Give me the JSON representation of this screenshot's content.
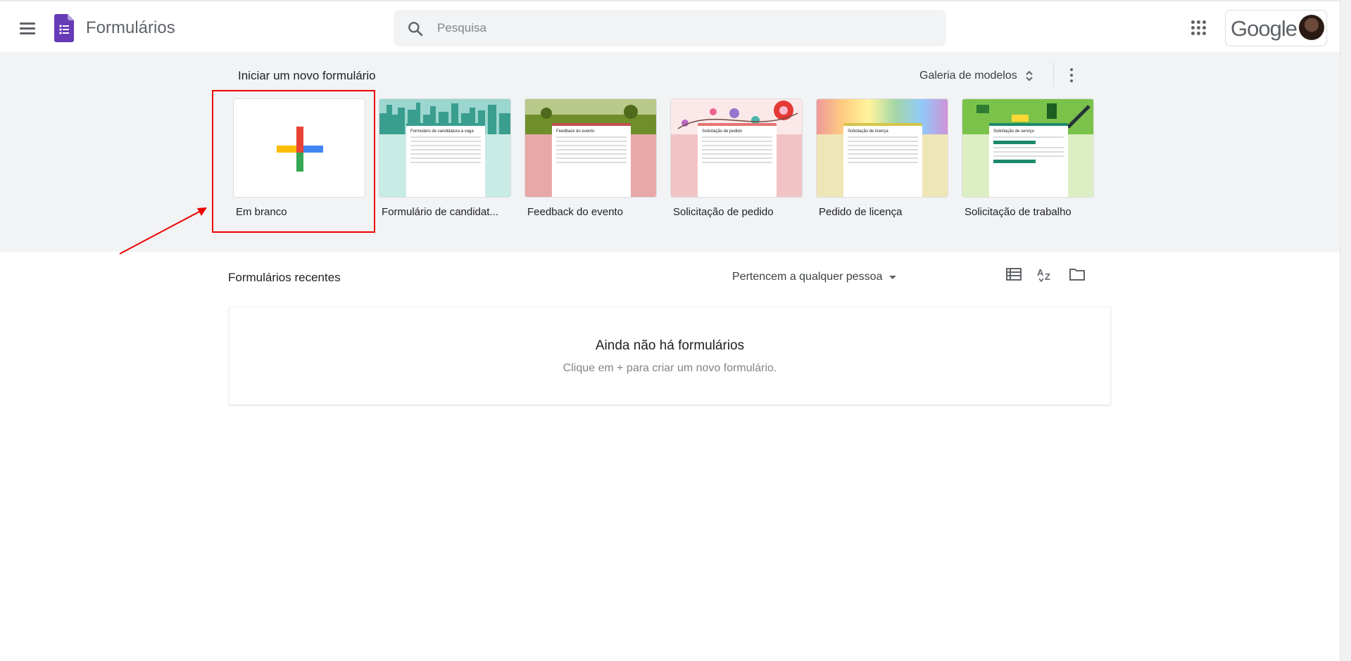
{
  "header": {
    "app_title": "Formulários",
    "search_placeholder": "Pesquisa",
    "account_brand": "Google",
    "brand_color": "#673ab7"
  },
  "gallery": {
    "title": "Iniciar um novo formulário",
    "gallery_button_label": "Galeria de modelos",
    "templates": [
      {
        "label": "Em branco",
        "thumbnail": "blank-plus"
      },
      {
        "label": "Formulário de candidat...",
        "heading": "Formulário de candidatura à vaga",
        "accent": "#3a9e8f"
      },
      {
        "label": "Feedback do evento",
        "heading": "Feedback do evento",
        "accent": "#c0504d"
      },
      {
        "label": "Solicitação de pedido",
        "heading": "Solicitação de pedido",
        "accent": "#e57373"
      },
      {
        "label": "Pedido de licença",
        "heading": "Solicitação de licença",
        "accent": "#d4c44a"
      },
      {
        "label": "Solicitação de trabalho",
        "heading": "Solicitação de serviço",
        "accent": "#1b8a6b"
      }
    ]
  },
  "recent": {
    "title": "Formulários recentes",
    "owner_filter": "Pertencem a qualquer pessoa",
    "empty_title": "Ainda não há formulários",
    "empty_hint": "Clique em + para criar um novo formulário."
  },
  "annotation": {
    "color": "#e00000"
  }
}
